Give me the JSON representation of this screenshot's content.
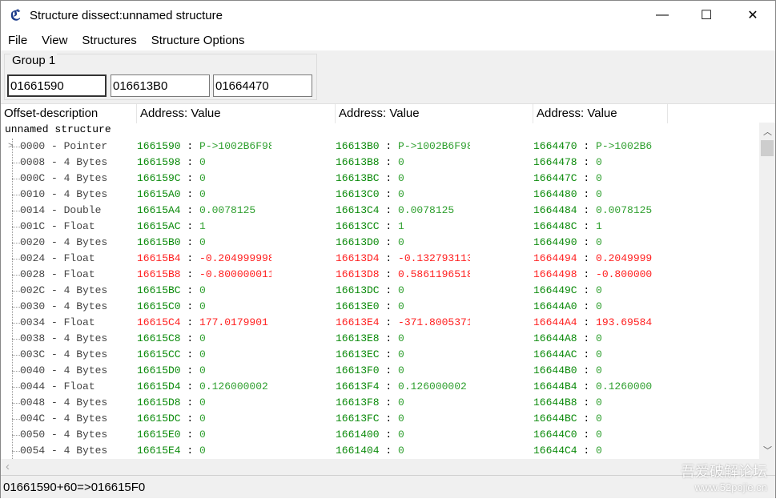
{
  "window": {
    "title": "Structure dissect:unnamed structure",
    "minimize": "—",
    "maximize": "☐",
    "close": "✕"
  },
  "menu": [
    "File",
    "View",
    "Structures",
    "Structure Options"
  ],
  "group": {
    "label": "Group 1",
    "addresses": [
      "01661590",
      "016613B0",
      "01664470"
    ]
  },
  "columns": [
    "Offset-description",
    "Address: Value",
    "Address: Value",
    "Address: Value"
  ],
  "root": "unnamed structure",
  "rows": [
    {
      "off": "0000 - Pointer",
      "changed": false,
      "c": [
        [
          "1661590",
          "P->1002B6F98"
        ],
        [
          "16613B0",
          "P->1002B6F98"
        ],
        [
          "1664470",
          "P->1002B6"
        ]
      ]
    },
    {
      "off": "0008 - 4 Bytes",
      "changed": false,
      "c": [
        [
          "1661598",
          "0"
        ],
        [
          "16613B8",
          "0"
        ],
        [
          "1664478",
          "0"
        ]
      ]
    },
    {
      "off": "000C - 4 Bytes",
      "changed": false,
      "c": [
        [
          "166159C",
          "0"
        ],
        [
          "16613BC",
          "0"
        ],
        [
          "166447C",
          "0"
        ]
      ]
    },
    {
      "off": "0010 - 4 Bytes",
      "changed": false,
      "c": [
        [
          "16615A0",
          "0"
        ],
        [
          "16613C0",
          "0"
        ],
        [
          "1664480",
          "0"
        ]
      ]
    },
    {
      "off": "0014 - Double",
      "changed": false,
      "c": [
        [
          "16615A4",
          "0.0078125"
        ],
        [
          "16613C4",
          "0.0078125"
        ],
        [
          "1664484",
          "0.0078125"
        ]
      ]
    },
    {
      "off": "001C - Float",
      "changed": false,
      "c": [
        [
          "16615AC",
          "1"
        ],
        [
          "16613CC",
          "1"
        ],
        [
          "166448C",
          "1"
        ]
      ]
    },
    {
      "off": "0020 - 4 Bytes",
      "changed": false,
      "c": [
        [
          "16615B0",
          "0"
        ],
        [
          "16613D0",
          "0"
        ],
        [
          "1664490",
          "0"
        ]
      ]
    },
    {
      "off": "0024 - Float",
      "changed": true,
      "c": [
        [
          "16615B4",
          "-0.2049999982"
        ],
        [
          "16613D4",
          "-0.1327931136"
        ],
        [
          "1664494",
          "0.2049999"
        ]
      ]
    },
    {
      "off": "0028 - Float",
      "changed": true,
      "c": [
        [
          "16615B8",
          "-0.8000000119"
        ],
        [
          "16613D8",
          "0.5861196518"
        ],
        [
          "1664498",
          "-0.800000"
        ]
      ]
    },
    {
      "off": "002C - 4 Bytes",
      "changed": false,
      "c": [
        [
          "16615BC",
          "0"
        ],
        [
          "16613DC",
          "0"
        ],
        [
          "166449C",
          "0"
        ]
      ]
    },
    {
      "off": "0030 - 4 Bytes",
      "changed": false,
      "c": [
        [
          "16615C0",
          "0"
        ],
        [
          "16613E0",
          "0"
        ],
        [
          "16644A0",
          "0"
        ]
      ]
    },
    {
      "off": "0034 - Float",
      "changed": true,
      "c": [
        [
          "16615C4",
          "177.0179901"
        ],
        [
          "16613E4",
          "-371.8005371"
        ],
        [
          "16644A4",
          "193.69584"
        ]
      ]
    },
    {
      "off": "0038 - 4 Bytes",
      "changed": false,
      "c": [
        [
          "16615C8",
          "0"
        ],
        [
          "16613E8",
          "0"
        ],
        [
          "16644A8",
          "0"
        ]
      ]
    },
    {
      "off": "003C - 4 Bytes",
      "changed": false,
      "c": [
        [
          "16615CC",
          "0"
        ],
        [
          "16613EC",
          "0"
        ],
        [
          "16644AC",
          "0"
        ]
      ]
    },
    {
      "off": "0040 - 4 Bytes",
      "changed": false,
      "c": [
        [
          "16615D0",
          "0"
        ],
        [
          "16613F0",
          "0"
        ],
        [
          "16644B0",
          "0"
        ]
      ]
    },
    {
      "off": "0044 - Float",
      "changed": false,
      "c": [
        [
          "16615D4",
          "0.126000002"
        ],
        [
          "16613F4",
          "0.126000002"
        ],
        [
          "16644B4",
          "0.1260000"
        ]
      ]
    },
    {
      "off": "0048 - 4 Bytes",
      "changed": false,
      "c": [
        [
          "16615D8",
          "0"
        ],
        [
          "16613F8",
          "0"
        ],
        [
          "16644B8",
          "0"
        ]
      ]
    },
    {
      "off": "004C - 4 Bytes",
      "changed": false,
      "c": [
        [
          "16615DC",
          "0"
        ],
        [
          "16613FC",
          "0"
        ],
        [
          "16644BC",
          "0"
        ]
      ]
    },
    {
      "off": "0050 - 4 Bytes",
      "changed": false,
      "c": [
        [
          "16615E0",
          "0"
        ],
        [
          "1661400",
          "0"
        ],
        [
          "16644C0",
          "0"
        ]
      ]
    },
    {
      "off": "0054 - 4 Bytes",
      "changed": false,
      "c": [
        [
          "16615E4",
          "0"
        ],
        [
          "1661404",
          "0"
        ],
        [
          "16644C4",
          "0"
        ]
      ]
    }
  ],
  "status": "01661590+60=>016615F0",
  "watermark": {
    "line1": "吾爱破解论坛",
    "line2": "www.52pojie.cn"
  }
}
